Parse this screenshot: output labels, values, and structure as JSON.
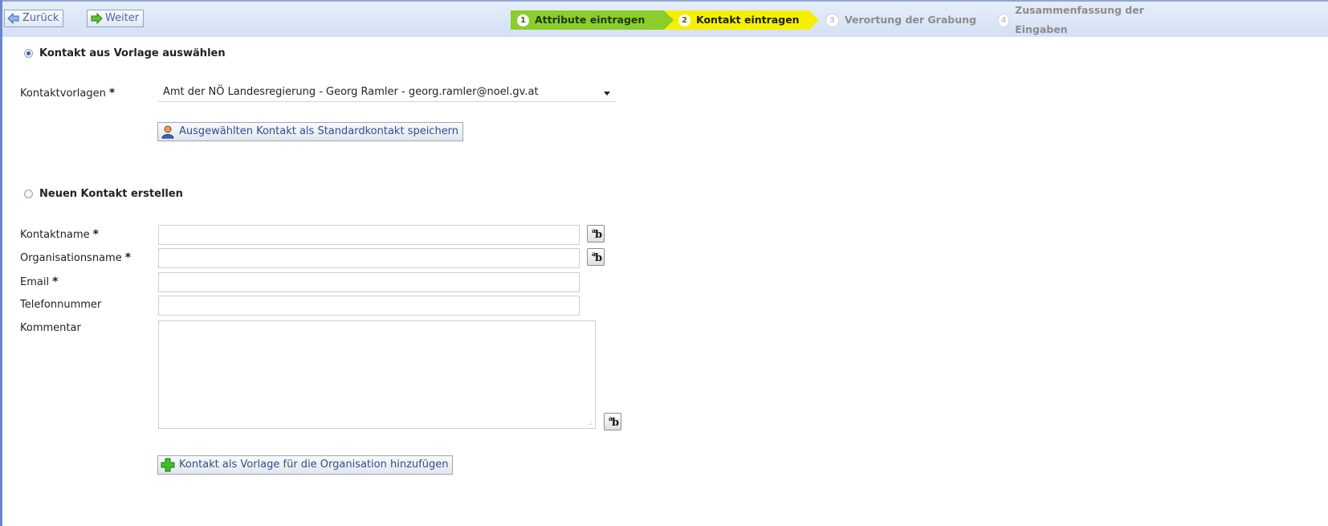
{
  "nav": {
    "back_label": "Zurück",
    "forward_label": "Weiter"
  },
  "wizard": {
    "steps": [
      {
        "num": "1",
        "label": "Attribute eintragen",
        "state": "done",
        "color": "#8bcd2b"
      },
      {
        "num": "2",
        "label": "Kontakt eintragen",
        "state": "active",
        "color": "#f4f000"
      },
      {
        "num": "3",
        "label": "Verortung der Grabung",
        "state": "pending"
      },
      {
        "num": "4",
        "label": "Zusammenfassung der Eingaben",
        "state": "pending"
      }
    ]
  },
  "template_section": {
    "radio_label": "Kontakt aus Vorlage auswählen",
    "selected": true,
    "field_label": "Kontaktvorlagen",
    "required_marker": "*",
    "selected_value": "Amt der NÖ Landesregierung - Georg Ramler - georg.ramler@noel.gv.at",
    "save_default_button": "Ausgewählten Kontakt als Standardkontakt speichern"
  },
  "new_contact_section": {
    "radio_label": "Neuen Kontakt erstellen",
    "selected": false,
    "fields": [
      {
        "label": "Kontaktname",
        "required": "*",
        "value": ""
      },
      {
        "label": "Organisationsname",
        "required": "*",
        "value": ""
      },
      {
        "label": "Email",
        "required": "*",
        "value": ""
      },
      {
        "label": "Telefonnummer",
        "required": "",
        "value": ""
      },
      {
        "label": "Kommentar",
        "required": "",
        "value": ""
      }
    ],
    "add_template_button": "Kontakt als Vorlage für die Organisation hinzufügen"
  },
  "colors": {
    "accent": "#2d4f93",
    "toolbar": "#d3e0f5"
  }
}
